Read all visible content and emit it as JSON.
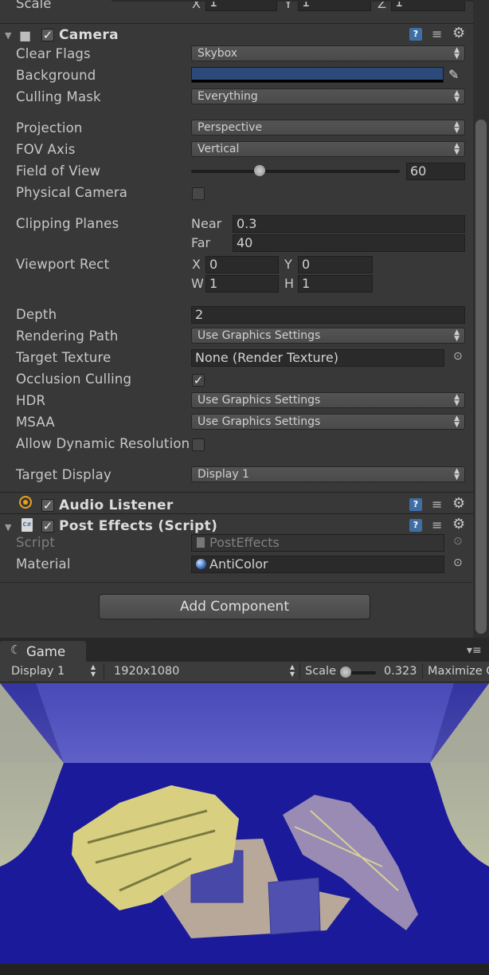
{
  "transform": {
    "scale_label": "Scale",
    "x": "1",
    "y": "1",
    "z": "1",
    "x_label": "X",
    "y_label": "Y",
    "z_label": "Z"
  },
  "camera": {
    "title": "Camera",
    "clear_flags": {
      "label": "Clear Flags",
      "value": "Skybox"
    },
    "background": {
      "label": "Background",
      "color": "#2b4a7a"
    },
    "culling_mask": {
      "label": "Culling Mask",
      "value": "Everything"
    },
    "projection": {
      "label": "Projection",
      "value": "Perspective"
    },
    "fov_axis": {
      "label": "FOV Axis",
      "value": "Vertical"
    },
    "field_of_view": {
      "label": "Field of View",
      "value": "60",
      "slider_fraction": 0.33
    },
    "physical_camera": {
      "label": "Physical Camera",
      "checked": false
    },
    "clipping": {
      "label": "Clipping Planes",
      "near_label": "Near",
      "near": "0.3",
      "far_label": "Far",
      "far": "40"
    },
    "viewport": {
      "label": "Viewport Rect",
      "x_label": "X",
      "x": "0",
      "y_label": "Y",
      "y": "0",
      "w_label": "W",
      "w": "1",
      "h_label": "H",
      "h": "1"
    },
    "depth": {
      "label": "Depth",
      "value": "2"
    },
    "rendering_path": {
      "label": "Rendering Path",
      "value": "Use Graphics Settings"
    },
    "target_texture": {
      "label": "Target Texture",
      "value": "None (Render Texture)"
    },
    "occlusion_culling": {
      "label": "Occlusion Culling",
      "checked": true
    },
    "hdr": {
      "label": "HDR",
      "value": "Use Graphics Settings"
    },
    "msaa": {
      "label": "MSAA",
      "value": "Use Graphics Settings"
    },
    "dynamic_resolution": {
      "label": "Allow Dynamic Resolution",
      "checked": false
    },
    "target_display": {
      "label": "Target Display",
      "value": "Display 1"
    }
  },
  "audio_listener": {
    "title": "Audio Listener"
  },
  "post_effects": {
    "title": "Post Effects (Script)",
    "script": {
      "label": "Script",
      "value": "PostEffects"
    },
    "material": {
      "label": "Material",
      "value": "AntiColor"
    }
  },
  "add_component": {
    "label": "Add Component"
  },
  "game_panel": {
    "tab_label": "Game",
    "display": "Display 1",
    "resolution": "1920x1080",
    "scale_label": "Scale",
    "scale_value": "0.323",
    "maximize_label": "Maximize O"
  },
  "colors": {
    "accent_blue": "#3f6ea5",
    "panel_bg": "#383838",
    "game_bg": "#1a1a8c"
  }
}
